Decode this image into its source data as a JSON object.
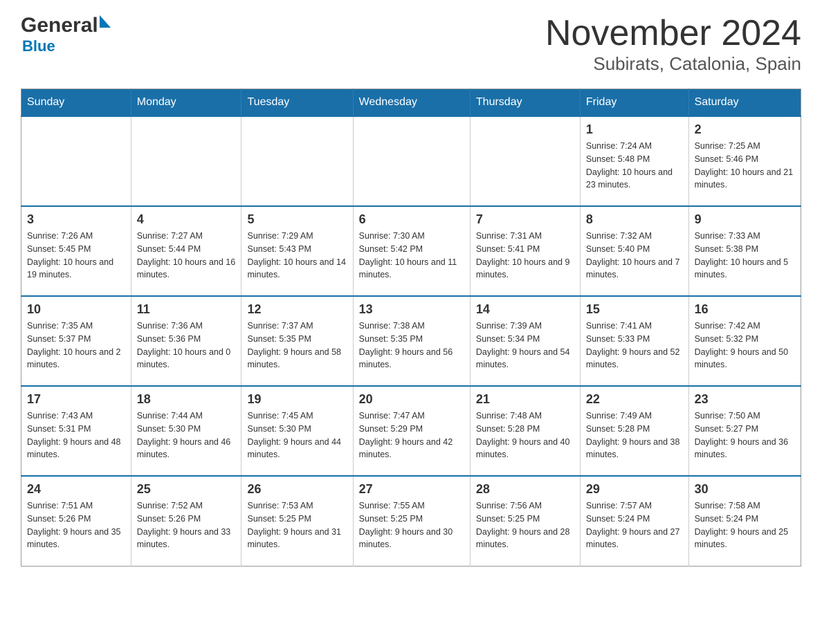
{
  "header": {
    "logo_general": "General",
    "logo_blue": "Blue",
    "title": "November 2024",
    "subtitle": "Subirats, Catalonia, Spain"
  },
  "calendar": {
    "days_of_week": [
      "Sunday",
      "Monday",
      "Tuesday",
      "Wednesday",
      "Thursday",
      "Friday",
      "Saturday"
    ],
    "weeks": [
      [
        {
          "day": "",
          "info": ""
        },
        {
          "day": "",
          "info": ""
        },
        {
          "day": "",
          "info": ""
        },
        {
          "day": "",
          "info": ""
        },
        {
          "day": "",
          "info": ""
        },
        {
          "day": "1",
          "info": "Sunrise: 7:24 AM\nSunset: 5:48 PM\nDaylight: 10 hours and 23 minutes."
        },
        {
          "day": "2",
          "info": "Sunrise: 7:25 AM\nSunset: 5:46 PM\nDaylight: 10 hours and 21 minutes."
        }
      ],
      [
        {
          "day": "3",
          "info": "Sunrise: 7:26 AM\nSunset: 5:45 PM\nDaylight: 10 hours and 19 minutes."
        },
        {
          "day": "4",
          "info": "Sunrise: 7:27 AM\nSunset: 5:44 PM\nDaylight: 10 hours and 16 minutes."
        },
        {
          "day": "5",
          "info": "Sunrise: 7:29 AM\nSunset: 5:43 PM\nDaylight: 10 hours and 14 minutes."
        },
        {
          "day": "6",
          "info": "Sunrise: 7:30 AM\nSunset: 5:42 PM\nDaylight: 10 hours and 11 minutes."
        },
        {
          "day": "7",
          "info": "Sunrise: 7:31 AM\nSunset: 5:41 PM\nDaylight: 10 hours and 9 minutes."
        },
        {
          "day": "8",
          "info": "Sunrise: 7:32 AM\nSunset: 5:40 PM\nDaylight: 10 hours and 7 minutes."
        },
        {
          "day": "9",
          "info": "Sunrise: 7:33 AM\nSunset: 5:38 PM\nDaylight: 10 hours and 5 minutes."
        }
      ],
      [
        {
          "day": "10",
          "info": "Sunrise: 7:35 AM\nSunset: 5:37 PM\nDaylight: 10 hours and 2 minutes."
        },
        {
          "day": "11",
          "info": "Sunrise: 7:36 AM\nSunset: 5:36 PM\nDaylight: 10 hours and 0 minutes."
        },
        {
          "day": "12",
          "info": "Sunrise: 7:37 AM\nSunset: 5:35 PM\nDaylight: 9 hours and 58 minutes."
        },
        {
          "day": "13",
          "info": "Sunrise: 7:38 AM\nSunset: 5:35 PM\nDaylight: 9 hours and 56 minutes."
        },
        {
          "day": "14",
          "info": "Sunrise: 7:39 AM\nSunset: 5:34 PM\nDaylight: 9 hours and 54 minutes."
        },
        {
          "day": "15",
          "info": "Sunrise: 7:41 AM\nSunset: 5:33 PM\nDaylight: 9 hours and 52 minutes."
        },
        {
          "day": "16",
          "info": "Sunrise: 7:42 AM\nSunset: 5:32 PM\nDaylight: 9 hours and 50 minutes."
        }
      ],
      [
        {
          "day": "17",
          "info": "Sunrise: 7:43 AM\nSunset: 5:31 PM\nDaylight: 9 hours and 48 minutes."
        },
        {
          "day": "18",
          "info": "Sunrise: 7:44 AM\nSunset: 5:30 PM\nDaylight: 9 hours and 46 minutes."
        },
        {
          "day": "19",
          "info": "Sunrise: 7:45 AM\nSunset: 5:30 PM\nDaylight: 9 hours and 44 minutes."
        },
        {
          "day": "20",
          "info": "Sunrise: 7:47 AM\nSunset: 5:29 PM\nDaylight: 9 hours and 42 minutes."
        },
        {
          "day": "21",
          "info": "Sunrise: 7:48 AM\nSunset: 5:28 PM\nDaylight: 9 hours and 40 minutes."
        },
        {
          "day": "22",
          "info": "Sunrise: 7:49 AM\nSunset: 5:28 PM\nDaylight: 9 hours and 38 minutes."
        },
        {
          "day": "23",
          "info": "Sunrise: 7:50 AM\nSunset: 5:27 PM\nDaylight: 9 hours and 36 minutes."
        }
      ],
      [
        {
          "day": "24",
          "info": "Sunrise: 7:51 AM\nSunset: 5:26 PM\nDaylight: 9 hours and 35 minutes."
        },
        {
          "day": "25",
          "info": "Sunrise: 7:52 AM\nSunset: 5:26 PM\nDaylight: 9 hours and 33 minutes."
        },
        {
          "day": "26",
          "info": "Sunrise: 7:53 AM\nSunset: 5:25 PM\nDaylight: 9 hours and 31 minutes."
        },
        {
          "day": "27",
          "info": "Sunrise: 7:55 AM\nSunset: 5:25 PM\nDaylight: 9 hours and 30 minutes."
        },
        {
          "day": "28",
          "info": "Sunrise: 7:56 AM\nSunset: 5:25 PM\nDaylight: 9 hours and 28 minutes."
        },
        {
          "day": "29",
          "info": "Sunrise: 7:57 AM\nSunset: 5:24 PM\nDaylight: 9 hours and 27 minutes."
        },
        {
          "day": "30",
          "info": "Sunrise: 7:58 AM\nSunset: 5:24 PM\nDaylight: 9 hours and 25 minutes."
        }
      ]
    ]
  }
}
